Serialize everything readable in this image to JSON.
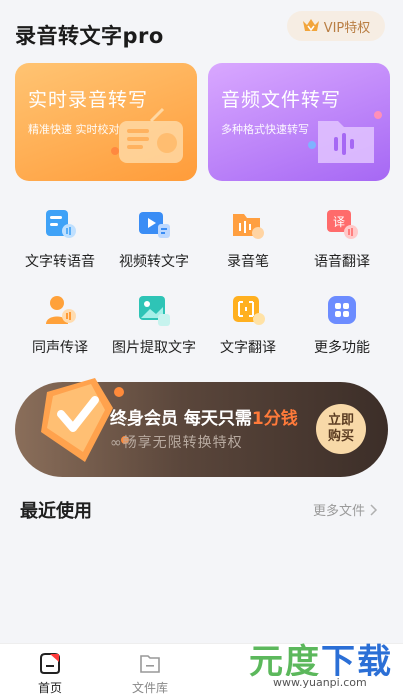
{
  "header": {
    "title": "录音转文字pro",
    "vip_label": "VIP特权"
  },
  "cards": [
    {
      "title": "实时录音转写",
      "subtitle": "精准快速 实时校对",
      "color": "#ffa84a"
    },
    {
      "title": "音频文件转写",
      "subtitle": "多种格式快速转写",
      "color": "#b67af7"
    }
  ],
  "tools": [
    {
      "label": "文字转语音",
      "icon": "text-to-speech-icon"
    },
    {
      "label": "视频转文字",
      "icon": "video-to-text-icon"
    },
    {
      "label": "录音笔",
      "icon": "recorder-folder-icon"
    },
    {
      "label": "语音翻译",
      "icon": "voice-translate-icon"
    },
    {
      "label": "同声传译",
      "icon": "simultaneous-interpret-icon"
    },
    {
      "label": "图片提取文字",
      "icon": "image-ocr-icon"
    },
    {
      "label": "文字翻译",
      "icon": "text-translate-icon"
    },
    {
      "label": "更多功能",
      "icon": "more-features-icon"
    }
  ],
  "banner": {
    "main_prefix": "终身会员 每天只需",
    "main_highlight": "1分钱",
    "sub": "∞畅享无限转换特权",
    "button_line1": "立即",
    "button_line2": "购买"
  },
  "recent": {
    "title": "最近使用",
    "more": "更多文件"
  },
  "tabs": [
    {
      "label": "首页",
      "active": true
    },
    {
      "label": "文件库",
      "active": false
    }
  ],
  "watermark": {
    "brand_a": "元度",
    "brand_b": "下载",
    "url": "www.yuanpi.com"
  },
  "colors": {
    "accent_orange": "#ff9c3a",
    "accent_purple": "#a668f4",
    "banner_dark": "#3c2e28",
    "highlight": "#ff7a3a"
  }
}
